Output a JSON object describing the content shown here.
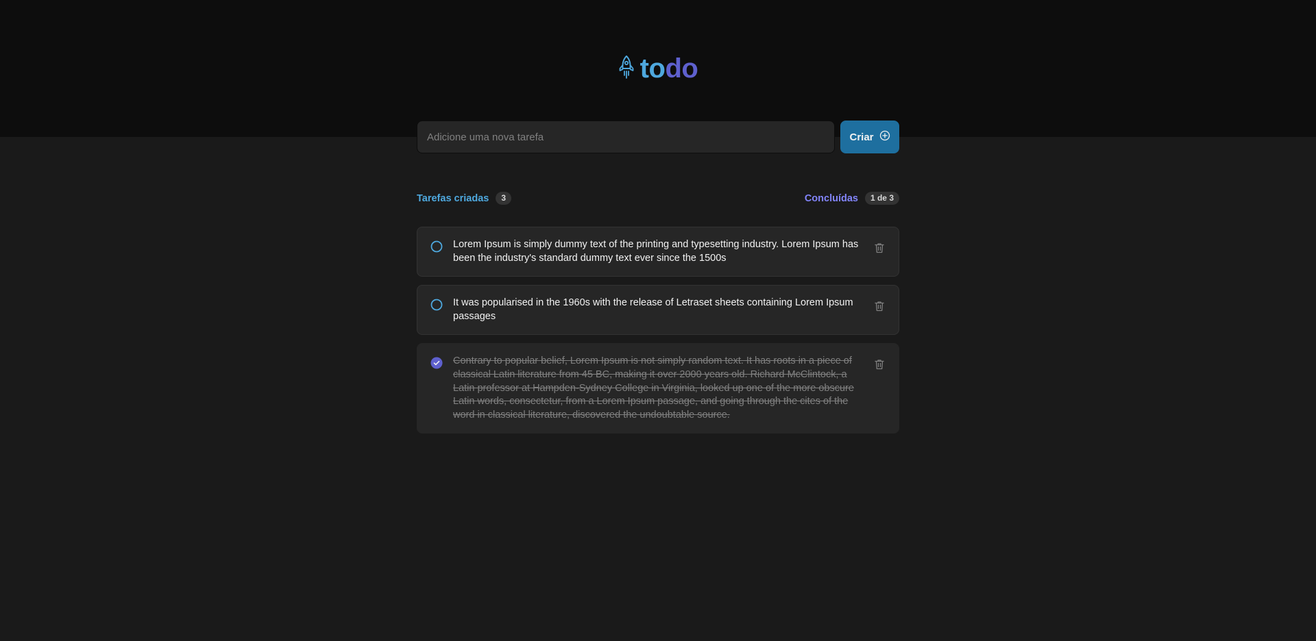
{
  "app": {
    "logo_part1": "to",
    "logo_part2": "do"
  },
  "new_task": {
    "placeholder": "Adicione uma nova tarefa",
    "value": "",
    "create_label": "Criar"
  },
  "counters": {
    "created_label": "Tarefas criadas",
    "created_count": "3",
    "done_label": "Concluídas",
    "done_count": "1 de 3"
  },
  "tasks": [
    {
      "text": "Lorem Ipsum is simply dummy text of the printing and typesetting industry. Lorem Ipsum has been the industry's standard dummy text ever since the 1500s",
      "done": false
    },
    {
      "text": "It was popularised in the 1960s with the release of Letraset sheets containing Lorem Ipsum passages",
      "done": false
    },
    {
      "text": "Contrary to popular belief, Lorem Ipsum is not simply random text. It has roots in a piece of classical Latin literature from 45 BC, making it over 2000 years old. Richard McClintock, a Latin professor at Hampden-Sydney College in Virginia, looked up one of the more obscure Latin words, consectetur, from a Lorem Ipsum passage, and going through the cites of the word in classical literature, discovered the undoubtable source.",
      "done": true
    }
  ],
  "colors": {
    "blue": "#4ea8de",
    "blue_dark": "#1e6f9f",
    "purple": "#8284fa",
    "purple_dark": "#5e60ce",
    "header_bg": "#0d0d0d",
    "page_bg": "#1a1a1a",
    "card_bg": "#262626"
  },
  "icons": {
    "logo": "rocket-icon",
    "create": "plus-circle-icon",
    "unchecked": "circle-outline-icon",
    "checked": "check-circle-icon",
    "delete": "trash-icon"
  }
}
